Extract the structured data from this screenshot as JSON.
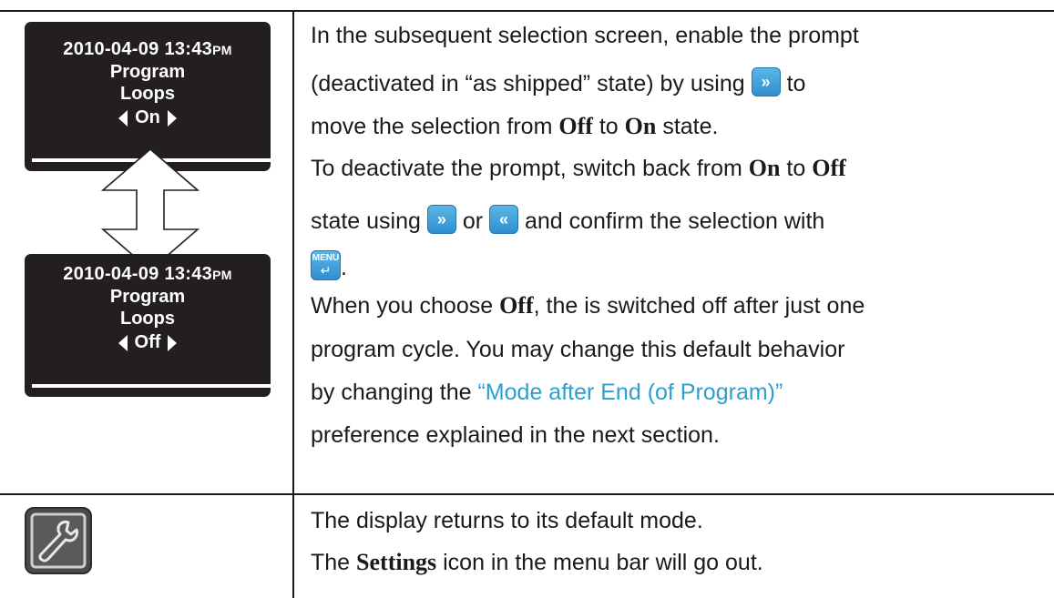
{
  "screens": [
    {
      "datetime": "2010-04-09  13:43",
      "ampm": "PM",
      "line1": "Program",
      "line2": "Loops",
      "value": "On"
    },
    {
      "datetime": "2010-04-09  13:43",
      "ampm": "PM",
      "line1": "Program",
      "line2": "Loops",
      "value": "Off"
    }
  ],
  "text": {
    "p1": "In the subsequent selection screen, enable the prompt",
    "p2a": "(deactivated in “as shipped” state) by using",
    "p2b": "to",
    "p3a": "move the selection from",
    "p3off": "Off",
    "p3b": "to",
    "p3on": "On",
    "p3c": "state.",
    "p4a": "To deactivate the prompt, switch back from",
    "p4on": "On",
    "p4b": "to",
    "p4off": "Off",
    "p5a": "state using",
    "p5b": "or",
    "p5c": "and confirm the selection with",
    "p6": ".",
    "p7a": "When you choose",
    "p7off": "Off",
    "p7b": ", the  is switched off after just one",
    "p8": "program cycle. You may change this default behavior",
    "p9a": "by changing the",
    "p9link": "“Mode after End (of Program)”",
    "p10": "preference explained in the next section.",
    "r2a": "The display returns to its default mode.",
    "r2b1": "The",
    "r2b_bold": "Settings",
    "r2b2": "icon in the menu bar will go out."
  },
  "buttons": {
    "menu_label": "MENU",
    "forward_glyph": "»",
    "back_glyph": "«",
    "enter_glyph": "↵"
  },
  "colors": {
    "link": "#2aa0d2",
    "button": "#3a9ad8",
    "lcd": "#231f20"
  }
}
